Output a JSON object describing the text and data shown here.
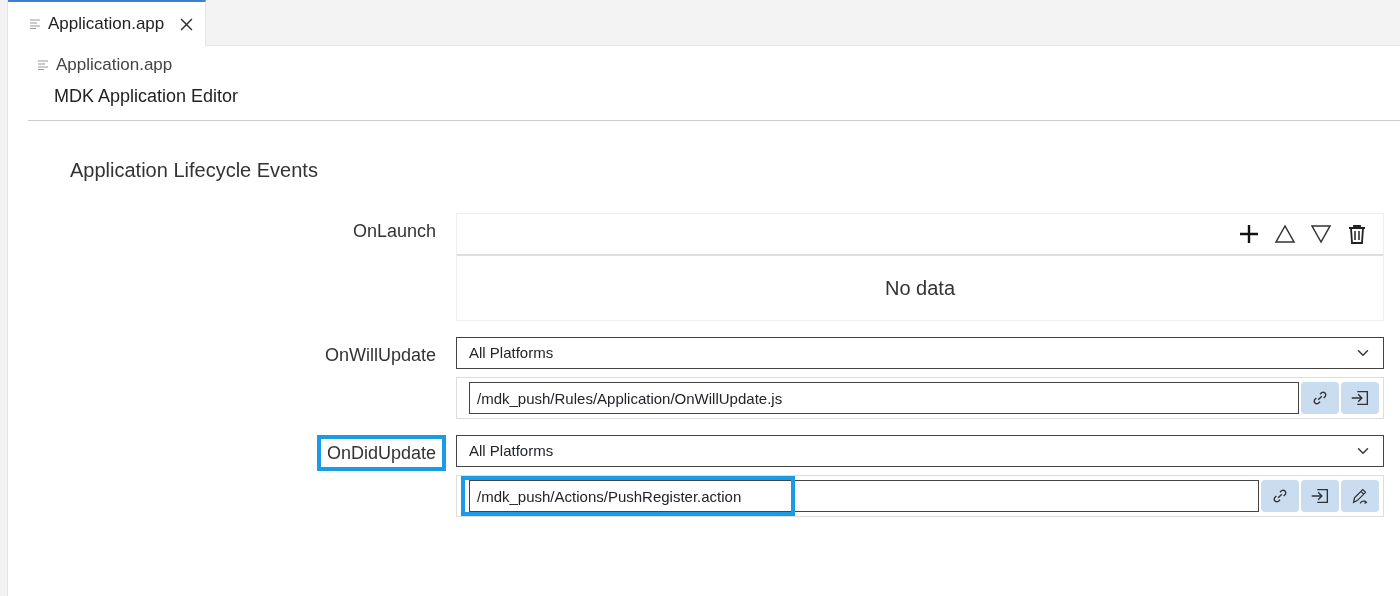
{
  "tabs": [
    {
      "label": "Application.app",
      "selected": true
    }
  ],
  "breadcrumb": "Application.app",
  "editor_title": "MDK Application Editor",
  "section_title": "Application Lifecycle Events",
  "events": [
    {
      "kind": "list",
      "label": "OnLaunch",
      "highlighted": false,
      "empty_text": "No data"
    },
    {
      "kind": "path",
      "label": "OnWillUpdate",
      "highlighted": false,
      "platform": "All Platforms",
      "path": "/mdk_push/Rules/Application/OnWillUpdate.js",
      "path_highlighted": false,
      "editable": false
    },
    {
      "kind": "path",
      "label": "OnDidUpdate",
      "highlighted": true,
      "platform": "All Platforms",
      "path": "/mdk_push/Actions/PushRegister.action",
      "path_highlighted": true,
      "editable": true
    }
  ]
}
